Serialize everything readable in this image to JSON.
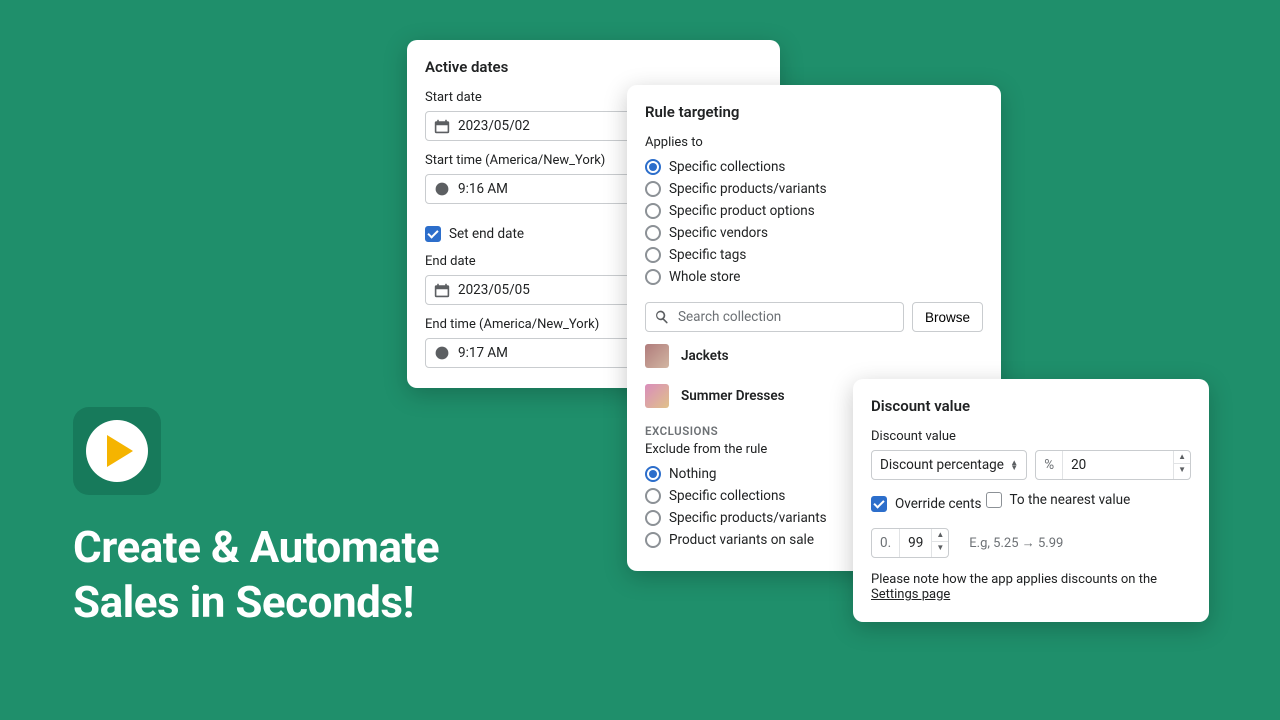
{
  "brand": {
    "headline": "Create & Automate\nSales in Seconds!"
  },
  "dates": {
    "title": "Active dates",
    "start_date_label": "Start date",
    "start_date_value": "2023/05/02",
    "start_time_label": "Start time (America/New_York)",
    "start_time_value": "9:16 AM",
    "set_end_checkbox": "Set end date",
    "set_end_checked": true,
    "end_date_label": "End date",
    "end_date_value": "2023/05/05",
    "end_time_label": "End time (America/New_York)",
    "end_time_value": "9:17 AM"
  },
  "targeting": {
    "title": "Rule targeting",
    "applies_label": "Applies to",
    "applies_options": [
      "Specific collections",
      "Specific products/variants",
      "Specific product options",
      "Specific vendors",
      "Specific tags",
      "Whole store"
    ],
    "applies_selected_index": 0,
    "search_placeholder": "Search collection",
    "browse_label": "Browse",
    "collections": [
      {
        "name": "Jackets"
      },
      {
        "name": "Summer Dresses"
      }
    ],
    "exclusions_caps": "EXCLUSIONS",
    "exclude_label": "Exclude from the rule",
    "exclude_options": [
      "Nothing",
      "Specific collections",
      "Specific products/variants",
      "Product variants on sale"
    ],
    "exclude_selected_index": 0
  },
  "discount": {
    "title": "Discount value",
    "value_label": "Discount value",
    "type_selected": "Discount percentage",
    "percent_prefix": "%",
    "percent_value": "20",
    "override_label": "Override cents",
    "override_checked": true,
    "nearest_label": "To the nearest value",
    "nearest_checked": false,
    "cents_prefix": "0.",
    "cents_value": "99",
    "example": "E.g, 5.25 → 5.99",
    "note_prefix": "Please note how the app applies discounts on the ",
    "note_link": "Settings page"
  }
}
